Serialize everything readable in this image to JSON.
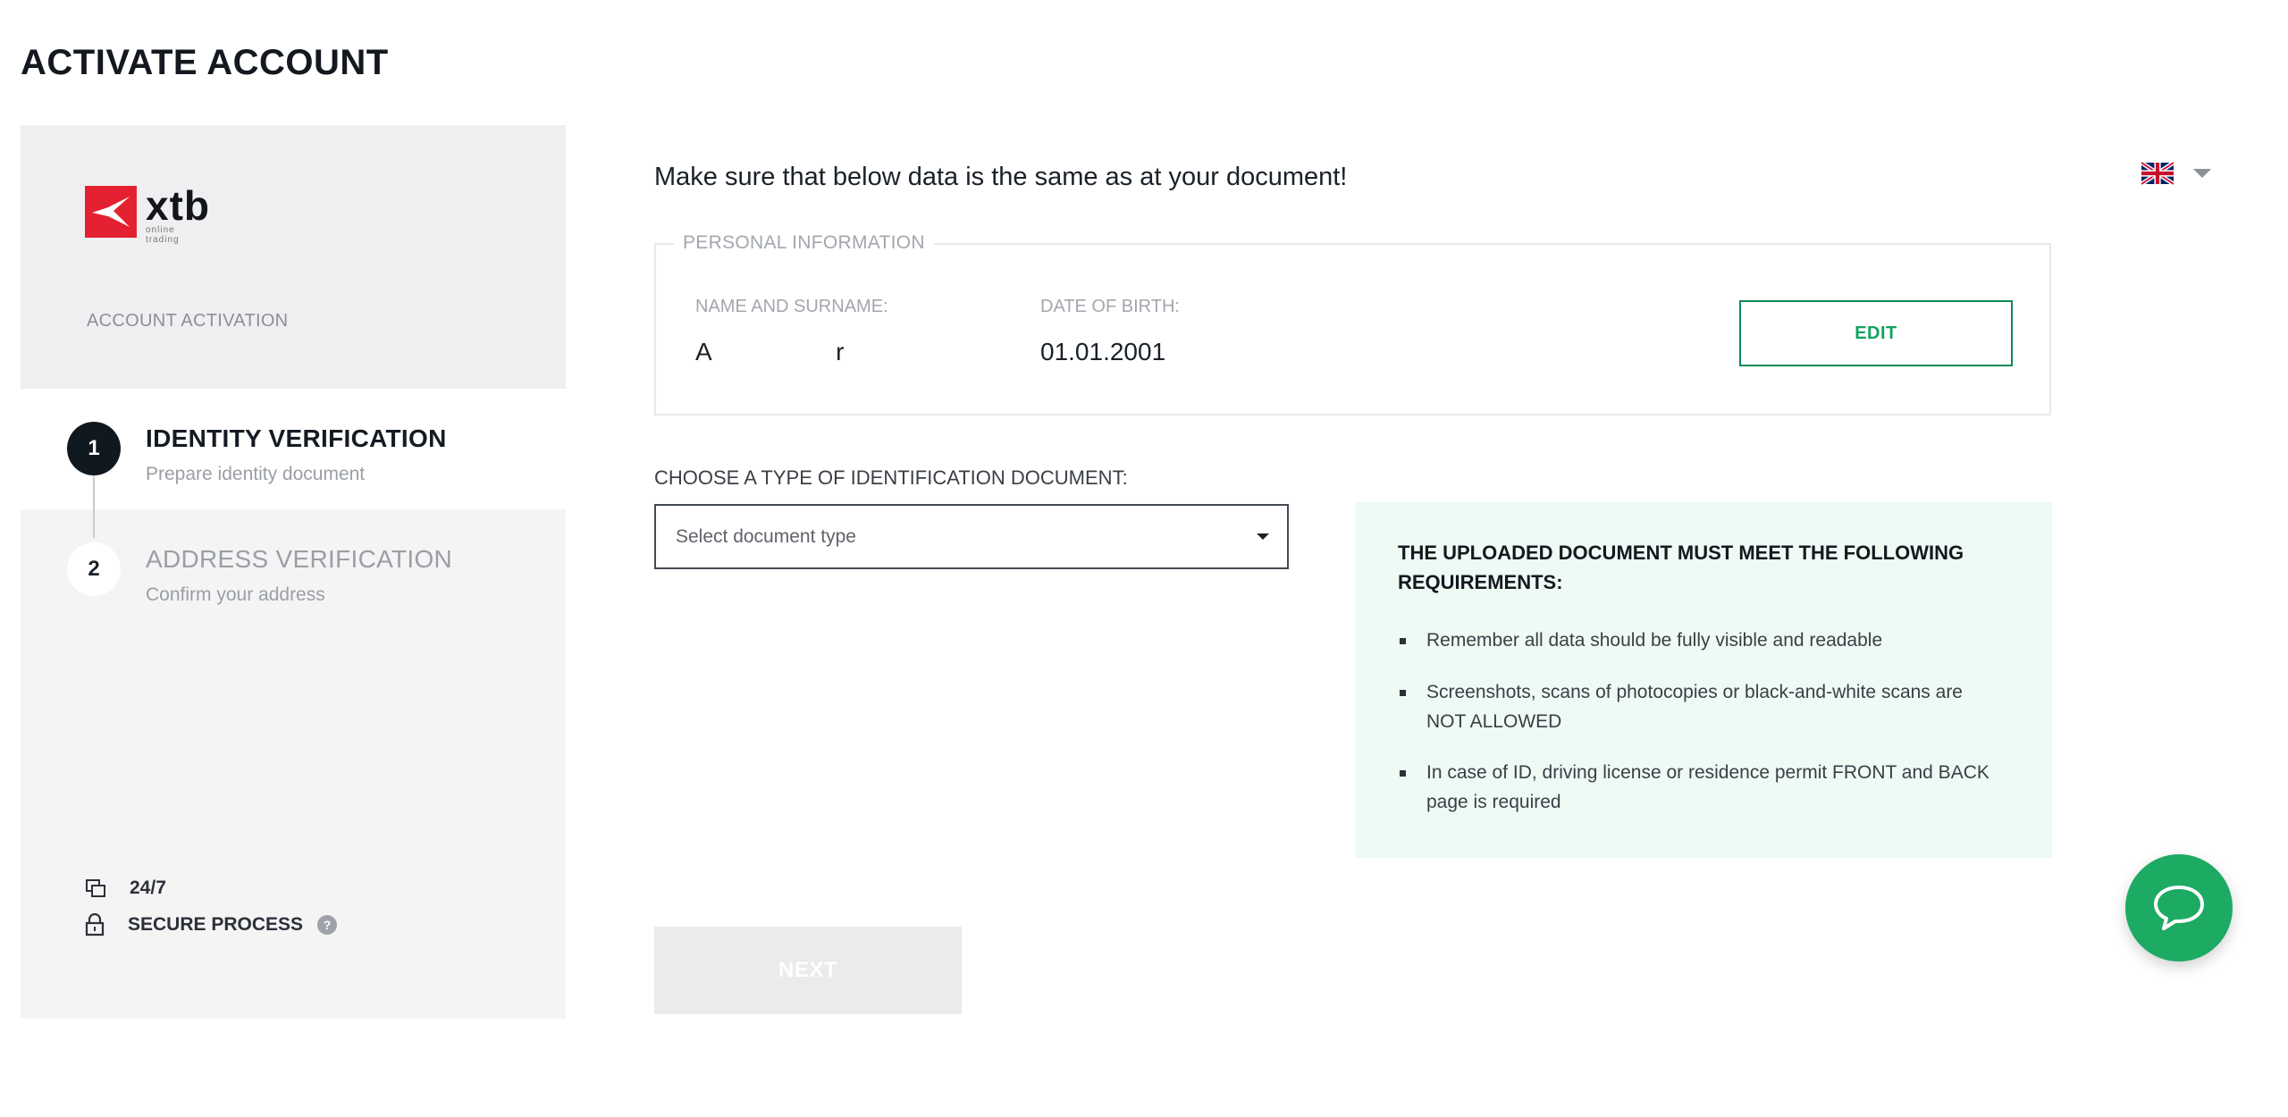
{
  "page": {
    "title": "ACTIVATE ACCOUNT"
  },
  "sidebar": {
    "logo_text": "xtb",
    "logo_subtext": "online trading",
    "section_label": "ACCOUNT ACTIVATION",
    "steps": [
      {
        "number": "1",
        "title": "IDENTITY VERIFICATION",
        "subtitle": "Prepare identity document",
        "state": "active"
      },
      {
        "number": "2",
        "title": "ADDRESS VERIFICATION",
        "subtitle": "Confirm your address",
        "state": "inactive"
      }
    ],
    "perks": [
      {
        "icon": "support-24-7-icon",
        "label": "24/7"
      },
      {
        "icon": "lock-icon",
        "label": "SECURE PROCESS",
        "help": "?"
      }
    ]
  },
  "language": {
    "selected": "English",
    "icon": "uk-flag-icon"
  },
  "main": {
    "notice": "Make sure that below data is the same as at your document!",
    "personal_info": {
      "legend": "PERSONAL INFORMATION",
      "name_label": "NAME AND SURNAME:",
      "name_value": "A                  r",
      "dob_label": "DATE OF BIRTH:",
      "dob_value": "01.01.2001",
      "edit_label": "EDIT"
    },
    "document": {
      "label": "CHOOSE A TYPE OF IDENTIFICATION DOCUMENT:",
      "select_value": "Select document type"
    },
    "requirements": {
      "title": "THE UPLOADED DOCUMENT MUST MEET THE FOLLOWING REQUIREMENTS:",
      "items": [
        "Remember all data should be fully visible and readable",
        "Screenshots, scans of photocopies or black-and-white scans are NOT ALLOWED",
        "In case of ID, driving license or residence permit FRONT and BACK page is required"
      ]
    },
    "next_label": "NEXT"
  },
  "chat": {
    "icon": "chat-bubble-icon"
  },
  "colors": {
    "brand_red": "#e42130",
    "accent_green": "#1daa63",
    "edit_green": "#12a361",
    "req_bg": "#eefaf4"
  }
}
